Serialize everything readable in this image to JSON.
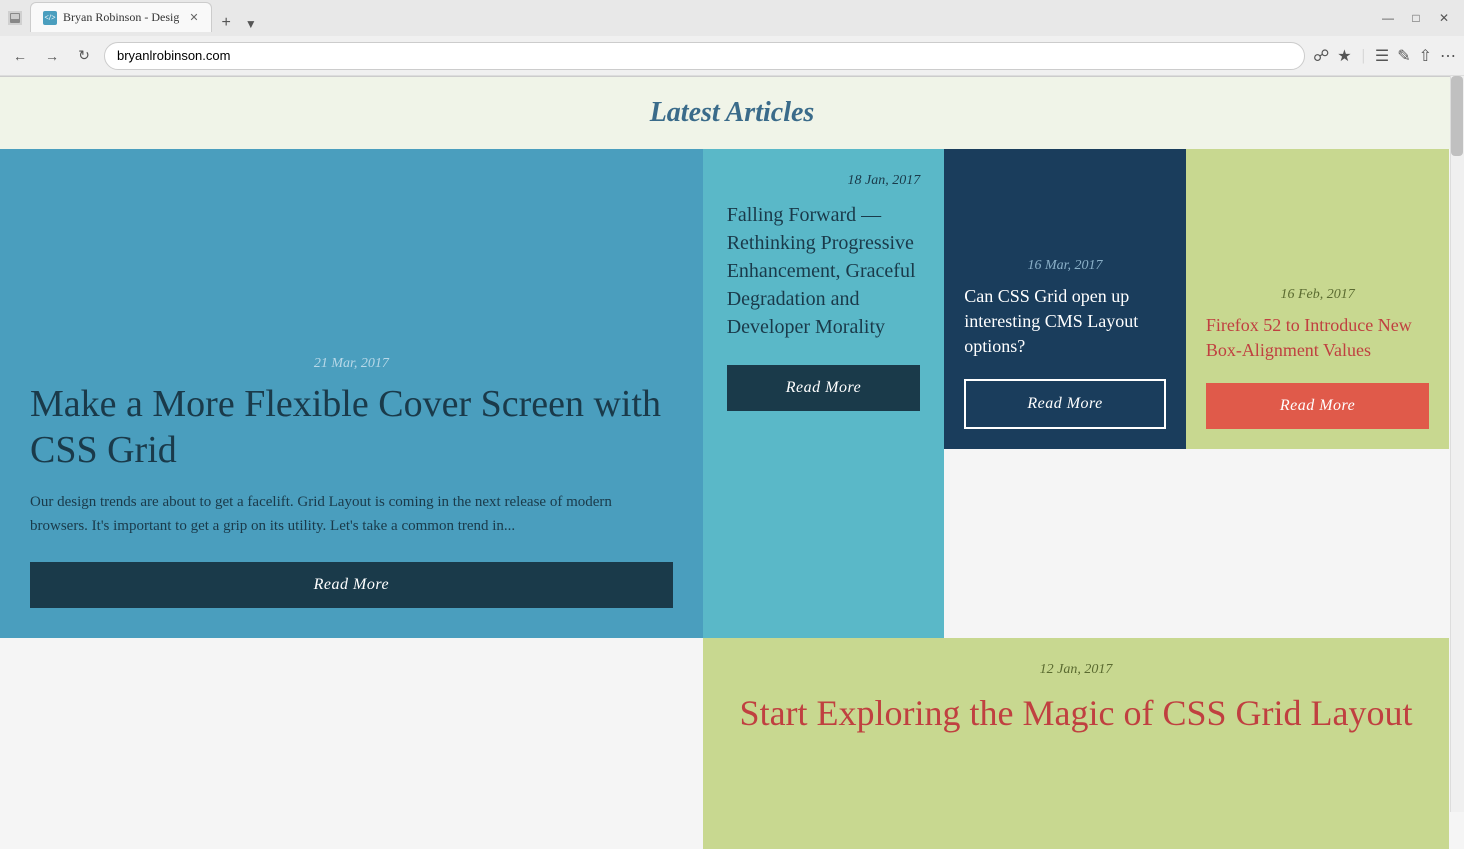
{
  "browser": {
    "url": "bryanlrobinson.com",
    "tab_title": "Bryan Robinson - Desig"
  },
  "page": {
    "header": "Latest Articles"
  },
  "articles": [
    {
      "id": "featured",
      "date": "21 Mar, 2017",
      "title": "Make a More Flexible Cover Screen with CSS Grid",
      "excerpt": "Our design trends are about to get a facelift. Grid Layout is coming in the next release of modern browsers. It's important to get a grip on its utility. Let's take a common trend in...",
      "btn_label": "Read More"
    },
    {
      "id": "card1",
      "date": "16 Mar, 2017",
      "title": "Can CSS Grid open up interesting CMS Layout options?",
      "btn_label": "Read More"
    },
    {
      "id": "card2",
      "date": "16 Feb, 2017",
      "title": "Firefox 52 to Introduce New Box-Alignment Values",
      "btn_label": "Read More"
    },
    {
      "id": "card3",
      "date": "18 Jan, 2017",
      "title": "Falling Forward — Rethinking Progressive Enhancement, Graceful Degradation and Developer Morality",
      "btn_label": "Read More"
    },
    {
      "id": "wide",
      "date": "12 Jan, 2017",
      "title": "Start Exploring the Magic of CSS Grid Layout"
    }
  ],
  "toolbar": {
    "nav": {
      "back": "←",
      "forward": "→",
      "refresh": "↻"
    }
  }
}
